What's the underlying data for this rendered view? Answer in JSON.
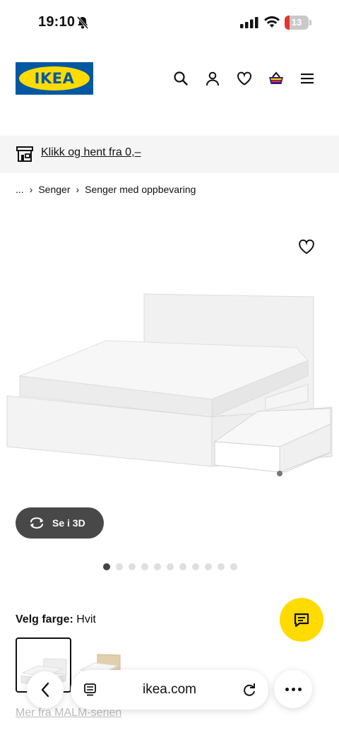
{
  "status_bar": {
    "time": "19:10",
    "battery": "13"
  },
  "header": {
    "logo_text": "IKEA"
  },
  "pickup": {
    "text": "Klikk og hent fra 0,–"
  },
  "breadcrumb": {
    "items": [
      "...",
      "Senger",
      "Senger med oppbevaring"
    ]
  },
  "gallery": {
    "view_3d_label": "Se i 3D",
    "dots_total": 11,
    "active_dot": 0
  },
  "product": {
    "color_label": "Velg farge:",
    "color_value": "Hvit",
    "series_link": "Mer fra MALM-serien"
  },
  "browser": {
    "url": "ikea.com"
  },
  "colors": {
    "ikea_blue": "#0058a3",
    "ikea_yellow": "#ffdb00",
    "dark_button": "#484848"
  }
}
